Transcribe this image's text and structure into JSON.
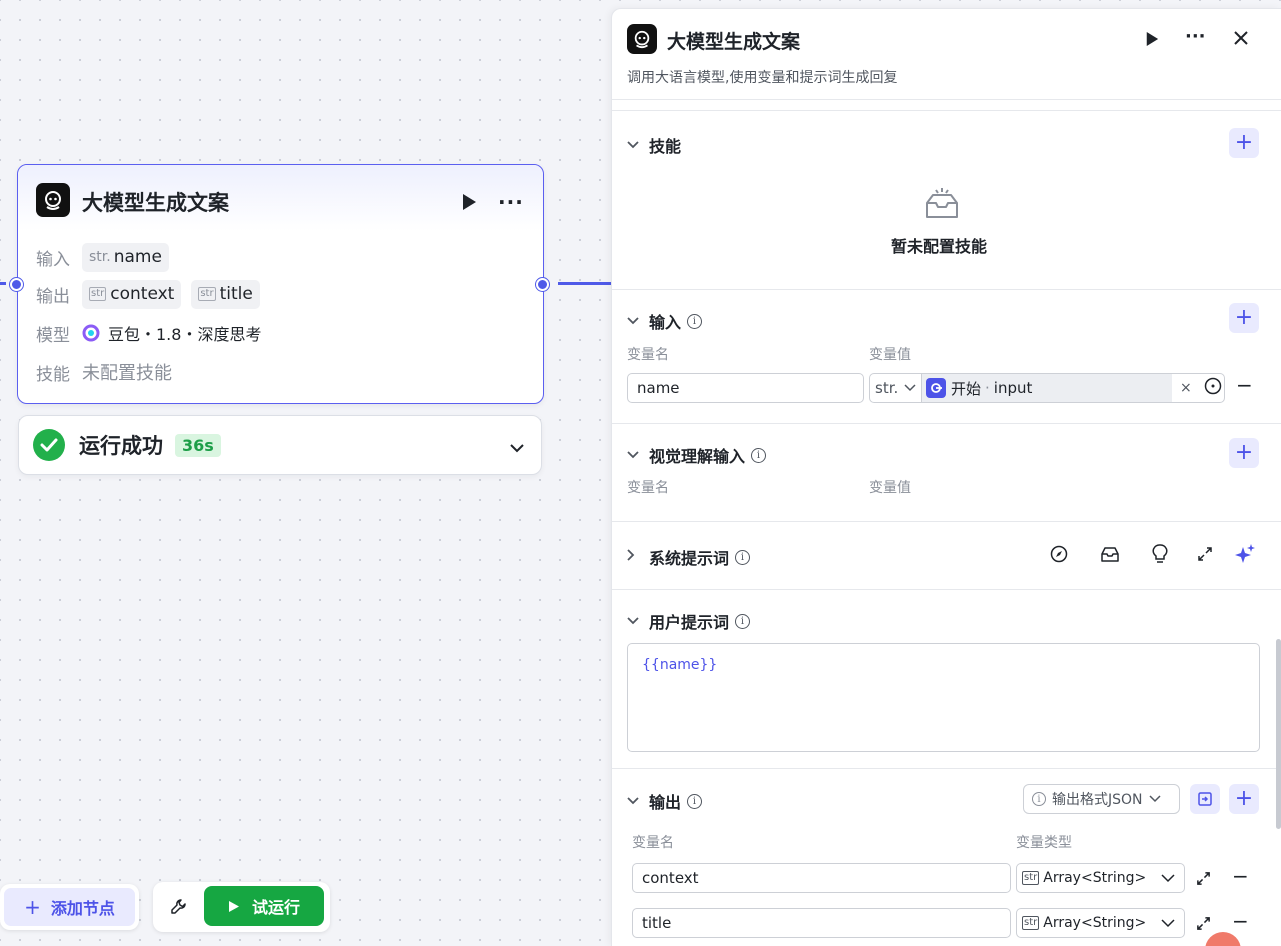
{
  "node": {
    "title": "大模型生成文案",
    "input_label": "输入",
    "input_type": "str.",
    "input_name": "name",
    "output_label": "输出",
    "output_type": "str",
    "outputs": [
      "context",
      "title"
    ],
    "model_label": "模型",
    "model_value": "豆包・1.8・深度思考",
    "skill_label": "技能",
    "skill_value": "未配置技能"
  },
  "run_status": {
    "text": "运行成功",
    "time": "36s"
  },
  "toolbar": {
    "add_node": "添加节点",
    "trial_run": "试运行"
  },
  "panel": {
    "title": "大模型生成文案",
    "subtitle": "调用大语言模型,使用变量和提示词生成回复",
    "skills": {
      "title": "技能",
      "empty": "暂未配置技能"
    },
    "inputs": {
      "title": "输入",
      "col_name": "变量名",
      "col_value": "变量值",
      "row": {
        "name": "name",
        "type": "str.",
        "source_node": "开始",
        "source_sep": "·",
        "source_var": "input"
      }
    },
    "vision": {
      "title": "视觉理解输入",
      "col_name": "变量名",
      "col_value": "变量值"
    },
    "system_prompt": {
      "title": "系统提示词"
    },
    "user_prompt": {
      "title": "用户提示词",
      "content": "{{name}}"
    },
    "outputs": {
      "title": "输出",
      "format": "输出格式JSON",
      "col_name": "变量名",
      "col_type": "变量类型",
      "rows": [
        {
          "name": "context",
          "type": "Array<String>"
        },
        {
          "name": "title",
          "type": "Array<String>"
        }
      ]
    }
  },
  "colors": {
    "accent": "#4d53e8",
    "success": "#22b04b",
    "run_button": "#16a742"
  }
}
